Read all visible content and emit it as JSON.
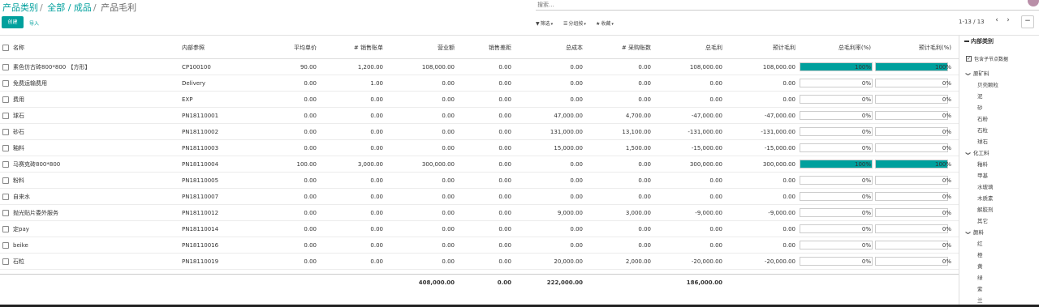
{
  "breadcrumb": {
    "root": "产品类别",
    "middle": "全部 / 成品",
    "current": "产品毛利"
  },
  "search": {
    "placeholder": "搜索..."
  },
  "toolbar": {
    "create": "创建",
    "import": "导入"
  },
  "filters": {
    "filter": "筛选",
    "group": "分组按",
    "favorite": "收藏"
  },
  "pager": {
    "text": "1-13 / 13",
    "prev": "‹",
    "next": "›"
  },
  "panel_toggle": "−",
  "columns": [
    "名称",
    "内部参照",
    "平均单价",
    "# 销售账单",
    "营业额",
    "销售差距",
    "总成本",
    "# 采购账数",
    "总毛利",
    "预计毛利",
    "总毛利率(%)",
    "预计毛利(%)"
  ],
  "rows": [
    {
      "name": "素色仿古砖800*800 【方形】",
      "ref": "CP100100",
      "avg": "90.00",
      "inv": "1,200.00",
      "rev": "108,000.00",
      "gap": "0.00",
      "cost": "0.00",
      "pur": "0.00",
      "margin": "108,000.00",
      "exp": "108,000.00",
      "rate": 100,
      "rate_text": "100%",
      "erate": 100,
      "erate_text": "100%"
    },
    {
      "name": "免费运输费用",
      "ref": "Delivery",
      "avg": "0.00",
      "inv": "1.00",
      "rev": "0.00",
      "gap": "0.00",
      "cost": "0.00",
      "pur": "0.00",
      "margin": "0.00",
      "exp": "0.00",
      "rate": 0,
      "rate_text": "0%",
      "erate": 0,
      "erate_text": "0%"
    },
    {
      "name": "费用",
      "ref": "EXP",
      "avg": "0.00",
      "inv": "0.00",
      "rev": "0.00",
      "gap": "0.00",
      "cost": "0.00",
      "pur": "0.00",
      "margin": "0.00",
      "exp": "0.00",
      "rate": 0,
      "rate_text": "0%",
      "erate": 0,
      "erate_text": "0%"
    },
    {
      "name": "球石",
      "ref": "PN18110001",
      "avg": "0.00",
      "inv": "0.00",
      "rev": "0.00",
      "gap": "0.00",
      "cost": "47,000.00",
      "pur": "4,700.00",
      "margin": "-47,000.00",
      "exp": "-47,000.00",
      "rate": 0,
      "rate_text": "0%",
      "erate": 0,
      "erate_text": "0%"
    },
    {
      "name": "砂石",
      "ref": "PN18110002",
      "avg": "0.00",
      "inv": "0.00",
      "rev": "0.00",
      "gap": "0.00",
      "cost": "131,000.00",
      "pur": "13,100.00",
      "margin": "-131,000.00",
      "exp": "-131,000.00",
      "rate": 0,
      "rate_text": "0%",
      "erate": 0,
      "erate_text": "0%"
    },
    {
      "name": "釉料",
      "ref": "PN18110003",
      "avg": "0.00",
      "inv": "0.00",
      "rev": "0.00",
      "gap": "0.00",
      "cost": "15,000.00",
      "pur": "1,500.00",
      "margin": "-15,000.00",
      "exp": "-15,000.00",
      "rate": 0,
      "rate_text": "0%",
      "erate": 0,
      "erate_text": "0%"
    },
    {
      "name": "马赛克砖800*800",
      "ref": "PN18110004",
      "avg": "100.00",
      "inv": "3,000.00",
      "rev": "300,000.00",
      "gap": "0.00",
      "cost": "0.00",
      "pur": "0.00",
      "margin": "300,000.00",
      "exp": "300,000.00",
      "rate": 100,
      "rate_text": "100%",
      "erate": 100,
      "erate_text": "100%"
    },
    {
      "name": "粉料",
      "ref": "PN18110005",
      "avg": "0.00",
      "inv": "0.00",
      "rev": "0.00",
      "gap": "0.00",
      "cost": "0.00",
      "pur": "0.00",
      "margin": "0.00",
      "exp": "0.00",
      "rate": 0,
      "rate_text": "0%",
      "erate": 0,
      "erate_text": "0%"
    },
    {
      "name": "自来水",
      "ref": "PN18110007",
      "avg": "0.00",
      "inv": "0.00",
      "rev": "0.00",
      "gap": "0.00",
      "cost": "0.00",
      "pur": "0.00",
      "margin": "0.00",
      "exp": "0.00",
      "rate": 0,
      "rate_text": "0%",
      "erate": 0,
      "erate_text": "0%"
    },
    {
      "name": "抛光贴片委外服务",
      "ref": "PN18110012",
      "avg": "0.00",
      "inv": "0.00",
      "rev": "0.00",
      "gap": "0.00",
      "cost": "9,000.00",
      "pur": "3,000.00",
      "margin": "-9,000.00",
      "exp": "-9,000.00",
      "rate": 0,
      "rate_text": "0%",
      "erate": 0,
      "erate_text": "0%"
    },
    {
      "name": "定pay",
      "ref": "PN18110014",
      "avg": "0.00",
      "inv": "0.00",
      "rev": "0.00",
      "gap": "0.00",
      "cost": "0.00",
      "pur": "0.00",
      "margin": "0.00",
      "exp": "0.00",
      "rate": 0,
      "rate_text": "0%",
      "erate": 0,
      "erate_text": "0%"
    },
    {
      "name": "beike",
      "ref": "PN18110016",
      "avg": "0.00",
      "inv": "0.00",
      "rev": "0.00",
      "gap": "0.00",
      "cost": "0.00",
      "pur": "0.00",
      "margin": "0.00",
      "exp": "0.00",
      "rate": 0,
      "rate_text": "0%",
      "erate": 0,
      "erate_text": "0%"
    },
    {
      "name": "石粒",
      "ref": "PN18110019",
      "avg": "0.00",
      "inv": "0.00",
      "rev": "0.00",
      "gap": "0.00",
      "cost": "20,000.00",
      "pur": "2,000.00",
      "margin": "-20,000.00",
      "exp": "-20,000.00",
      "rate": 0,
      "rate_text": "0%",
      "erate": 0,
      "erate_text": "0%"
    }
  ],
  "totals": {
    "rev": "408,000.00",
    "gap": "0.00",
    "cost": "222,000.00",
    "margin": "186,000.00"
  },
  "sidebar": {
    "title": "内部类别",
    "include_children": "包含子节点数据",
    "categories": [
      {
        "name": "原矿料",
        "children": [
          "贝壳颗粒",
          "泥",
          "砂",
          "石粉",
          "石粒",
          "球石"
        ]
      },
      {
        "name": "化工料",
        "children": [
          "釉料",
          "甲基",
          "水玻璃",
          "木质素",
          "解胶剂",
          "其它"
        ]
      },
      {
        "name": "颜料",
        "children": [
          "红",
          "橙",
          "黄",
          "绿",
          "紫",
          "兰"
        ]
      }
    ]
  },
  "colors": {
    "accent": "#00a09d"
  }
}
